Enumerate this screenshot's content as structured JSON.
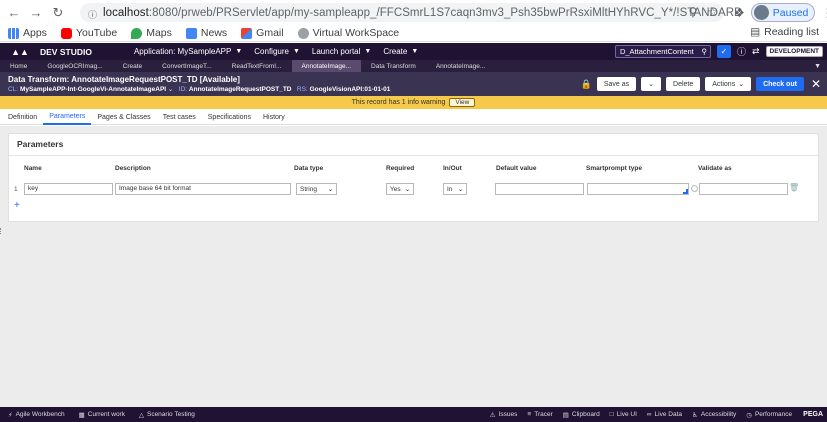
{
  "browser": {
    "url_host": "localhost",
    "url_path": ":8080/prweb/PRServlet/app/my-sampleapp_/FFCSmrL1S7caqn3mv3_Psh35bwPrRsxiMltHYhRVC_Y*/!STANDARD",
    "paused_label": "Paused",
    "bookmarks": [
      {
        "label": "Apps",
        "icon": "apps-grid-icon",
        "color": "#4285f4"
      },
      {
        "label": "YouTube",
        "icon": "youtube-icon",
        "color": "#ff0000"
      },
      {
        "label": "Maps",
        "icon": "maps-pin-icon",
        "color": "#34a853"
      },
      {
        "label": "News",
        "icon": "news-icon",
        "color": "#4285f4"
      },
      {
        "label": "Gmail",
        "icon": "gmail-icon",
        "color": "#ea4335"
      },
      {
        "label": "Virtual WorkSpace",
        "icon": "workspace-icon",
        "color": "#5f6368"
      }
    ],
    "reading_list": "Reading list"
  },
  "pega_header": {
    "studio": "DEV STUDIO",
    "application_menu": "Application: MySampleAPP",
    "configure_menu": "Configure",
    "launch_menu": "Launch portal",
    "create_menu": "Create",
    "search_value": "D_AttachmentContent",
    "dev_badge": "DEVELOPMENT"
  },
  "pega_tabs": [
    {
      "label": "Home",
      "active": false
    },
    {
      "label": "GoogleOCRImag...",
      "active": false
    },
    {
      "label": "Create",
      "active": false
    },
    {
      "label": "ConvertImageT...",
      "active": false
    },
    {
      "label": "ReadTextFromI...",
      "active": false
    },
    {
      "label": "AnnotateImage...",
      "active": true
    },
    {
      "label": "Data Transform",
      "active": false
    },
    {
      "label": "AnnotateImage...",
      "active": false
    }
  ],
  "record": {
    "title": "Data Transform: AnnotateImageRequestPOST_TD [Available]",
    "cl_key": "CL:",
    "cl_value": "MySampleAPP-Int-GoogleVi-AnnotateImageAPI",
    "id_key": "ID:",
    "id_value": "AnnotateImageRequestPOST_TD",
    "rs_key": "RS:",
    "rs_value": "GoogleVisionAPI:01-01-01",
    "save_as": "Save as",
    "delete": "Delete",
    "actions": "Actions",
    "check_out": "Check out"
  },
  "warning": {
    "text": "This record has 1 info warning",
    "view": "View"
  },
  "record_tabs": [
    {
      "label": "Definition",
      "active": false
    },
    {
      "label": "Parameters",
      "active": true
    },
    {
      "label": "Pages & Classes",
      "active": false
    },
    {
      "label": "Test cases",
      "active": false
    },
    {
      "label": "Specifications",
      "active": false
    },
    {
      "label": "History",
      "active": false
    }
  ],
  "parameters": {
    "title": "Parameters",
    "columns": [
      "Name",
      "Description",
      "Data type",
      "Required",
      "In/Out",
      "Default value",
      "Smartprompt type",
      "Validate as"
    ],
    "rows": [
      {
        "index": "1",
        "name": "key",
        "description": "Image base 64 bit format",
        "data_type": "String",
        "required": "Yes",
        "in_out": "In",
        "default_value": "",
        "smartprompt_type": "",
        "validate_as": ""
      }
    ]
  },
  "bottom_bar": {
    "left": [
      {
        "label": "Agile Workbench",
        "icon": "workbench-icon"
      },
      {
        "label": "Current work",
        "icon": "calendar-icon"
      },
      {
        "label": "Scenario Testing",
        "icon": "scenario-icon"
      }
    ],
    "right": [
      {
        "label": "Issues",
        "icon": "warning-icon"
      },
      {
        "label": "Tracer",
        "icon": "tracer-icon"
      },
      {
        "label": "Clipboard",
        "icon": "clipboard-icon"
      },
      {
        "label": "Live UI",
        "icon": "live-ui-icon"
      },
      {
        "label": "Live Data",
        "icon": "live-data-icon"
      },
      {
        "label": "Accessibility",
        "icon": "accessibility-icon"
      },
      {
        "label": "Performance",
        "icon": "performance-icon"
      }
    ],
    "brand": "PEGA"
  }
}
